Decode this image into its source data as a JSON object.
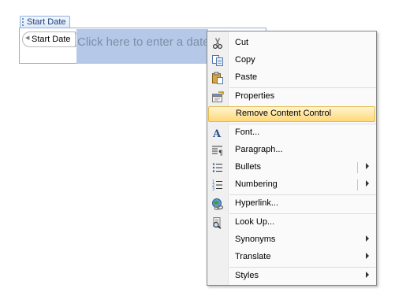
{
  "content_control": {
    "tab_title": "Start Date",
    "field_label": "Start Date",
    "placeholder": "Click here to enter a date."
  },
  "context_menu": {
    "items": [
      {
        "label": "Cut",
        "icon": "scissors-icon"
      },
      {
        "label": "Copy",
        "icon": "copy-icon"
      },
      {
        "label": "Paste",
        "icon": "paste-icon"
      },
      {
        "label": "Properties",
        "icon": "properties-icon"
      },
      {
        "label": "Remove Content Control",
        "highlighted": true
      },
      {
        "label": "Font...",
        "icon": "font-icon"
      },
      {
        "label": "Paragraph...",
        "icon": "paragraph-icon"
      },
      {
        "label": "Bullets",
        "icon": "bullets-icon",
        "submenu": true
      },
      {
        "label": "Numbering",
        "icon": "numbering-icon",
        "submenu": true
      },
      {
        "label": "Hyperlink...",
        "icon": "hyperlink-icon"
      },
      {
        "label": "Look Up...",
        "icon": "lookup-icon"
      },
      {
        "label": "Synonyms",
        "submenu": true
      },
      {
        "label": "Translate",
        "submenu": true
      },
      {
        "label": "Styles",
        "submenu": true
      }
    ]
  },
  "colors": {
    "highlight": "#ffd97a",
    "placeholder_bg": "#b5c8e7",
    "control_border": "#8fb0db"
  }
}
